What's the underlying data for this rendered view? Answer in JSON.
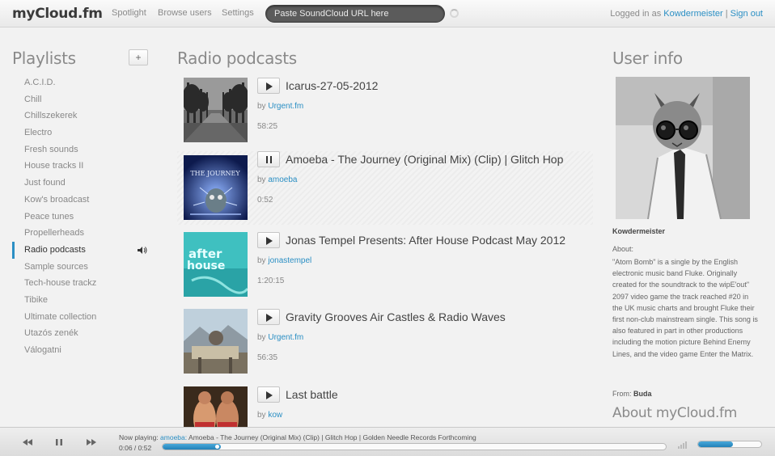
{
  "header": {
    "logo": "myCloud.fm",
    "nav": [
      "Spotlight",
      "Browse users",
      "Settings"
    ],
    "search_placeholder": "Paste SoundCloud URL here",
    "logged_in_prefix": "Logged in as",
    "username": "Kowdermeister",
    "separator": "|",
    "signout": "Sign out"
  },
  "playlists": {
    "title": "Playlists",
    "add_label": "+",
    "items": [
      "A.C.I.D.",
      "Chill",
      "Chillszekerek",
      "Electro",
      "Fresh sounds",
      "House tracks II",
      "Just found",
      "Kow's broadcast",
      "Peace tunes",
      "Propellerheads",
      "Radio podcasts",
      "Sample sources",
      "Tech-house trackz",
      "Tibike",
      "Ultimate collection",
      "Utazós zenék",
      "Válogatni"
    ],
    "active_index": 10
  },
  "main": {
    "title": "Radio podcasts",
    "by_label": "by",
    "tracks": [
      {
        "title": "Icarus-27-05-2012",
        "author": "Urgent.fm",
        "duration": "58:25",
        "state": "play"
      },
      {
        "title": "Amoeba - The Journey (Original Mix) (Clip) | Glitch Hop",
        "author": "amoeba",
        "duration": "0:52",
        "state": "pause"
      },
      {
        "title": "Jonas Tempel Presents: After House Podcast May 2012",
        "author": "jonastempel",
        "duration": "1:20:15",
        "state": "play"
      },
      {
        "title": "Gravity Grooves Air Castles & Radio Waves",
        "author": "Urgent.fm",
        "duration": "56:35",
        "state": "play"
      },
      {
        "title": "Last battle",
        "author": "kow",
        "duration": "",
        "state": "play"
      }
    ]
  },
  "user_info": {
    "title": "User info",
    "name": "Kowdermeister",
    "about_label": "About:",
    "about": "\"Atom Bomb\" is a single by the English electronic music band Fluke. Originally created for the soundtrack to the wipE'out\" 2097 video game the track reached #20 in the UK music charts and brought Fluke their first non-club mainstream single. This song is also featured in part in other productions including the motion picture Behind Enemy Lines, and the video game Enter the Matrix.",
    "from_label": "From:",
    "from": "Buda",
    "about_site_title": "About myCloud.fm"
  },
  "player": {
    "now_playing_label": "Now playing:",
    "artist": "amoeba:",
    "track": "Amoeba - The Journey (Original Mix) (Clip) | Glitch Hop | Golden Needle Records Forthcoming",
    "time": "0:06 / 0:52",
    "progress": 0.115,
    "volume": 0.55,
    "accent": "#2b8fc4"
  }
}
